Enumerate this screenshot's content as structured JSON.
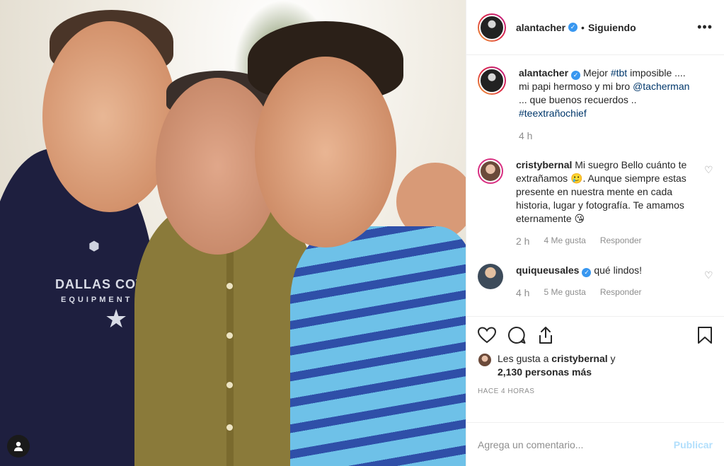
{
  "header": {
    "username": "alantacher",
    "separator": "•",
    "follow_status": "Siguiendo",
    "more_label": "•••"
  },
  "caption": {
    "username": "alantacher",
    "text_1": "Mejor",
    "hashtag_1": "#tbt",
    "text_2": "imposible ....",
    "text_3": "mi papi hermoso y mi bro",
    "mention": "@tacherman",
    "text_4": "... que buenos recuerdos ..",
    "hashtag_2": "#teextrañochief",
    "time": "4 h"
  },
  "comments": [
    {
      "username": "cristybernal",
      "text": "Mi suegro Bello cuánto te extrañamos 🥲. Aunque siempre estas presente en nuestra mente en cada historia, lugar y fotografía. Te amamos eternamente 😘",
      "time": "2 h",
      "likes": "4 Me gusta",
      "reply": "Responder"
    },
    {
      "username": "quiqueusales",
      "text": "qué lindos!",
      "time": "4 h",
      "likes": "5 Me gusta",
      "reply": "Responder"
    }
  ],
  "likes": {
    "prefix": "Les gusta a",
    "user": "cristybernal",
    "conj": "y",
    "others": "2,130 personas más"
  },
  "post_time": "HACE 4 HORAS",
  "add_comment": {
    "placeholder": "Agrega un comentario...",
    "post_label": "Publicar"
  },
  "photo": {
    "shirt_text": "DALLAS COWBOYS",
    "shirt_sub": "EQUIPMENT"
  },
  "colors": {
    "verified": "#3897f0",
    "link": "#00376b",
    "muted": "#8e8e8e",
    "publish_disabled": "#b2dffc"
  }
}
